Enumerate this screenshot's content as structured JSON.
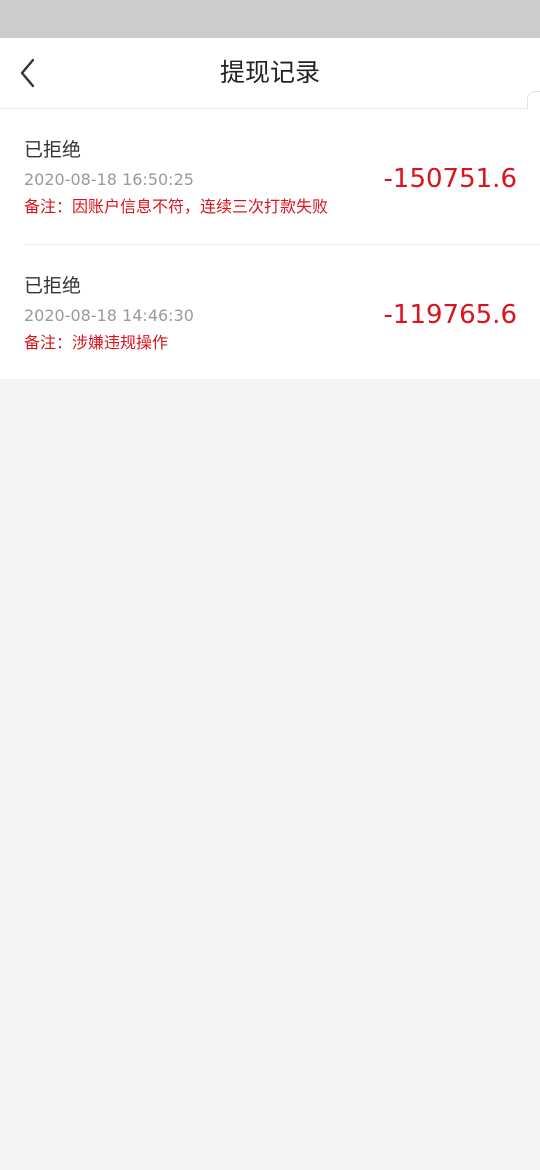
{
  "header": {
    "title": "提现记录",
    "back_icon": "chevron-left-icon"
  },
  "records": [
    {
      "status": "已拒绝",
      "time": "2020-08-18 16:50:25",
      "note": "备注：因账户信息不符，连续三次打款失败",
      "amount": "-150751.6"
    },
    {
      "status": "已拒绝",
      "time": "2020-08-18 14:46:30",
      "note": "备注：涉嫌违规操作",
      "amount": "-119765.6"
    }
  ],
  "colors": {
    "accent_red": "#d9141e",
    "status_bar": "#cccccc",
    "background": "#f5f5f5"
  }
}
